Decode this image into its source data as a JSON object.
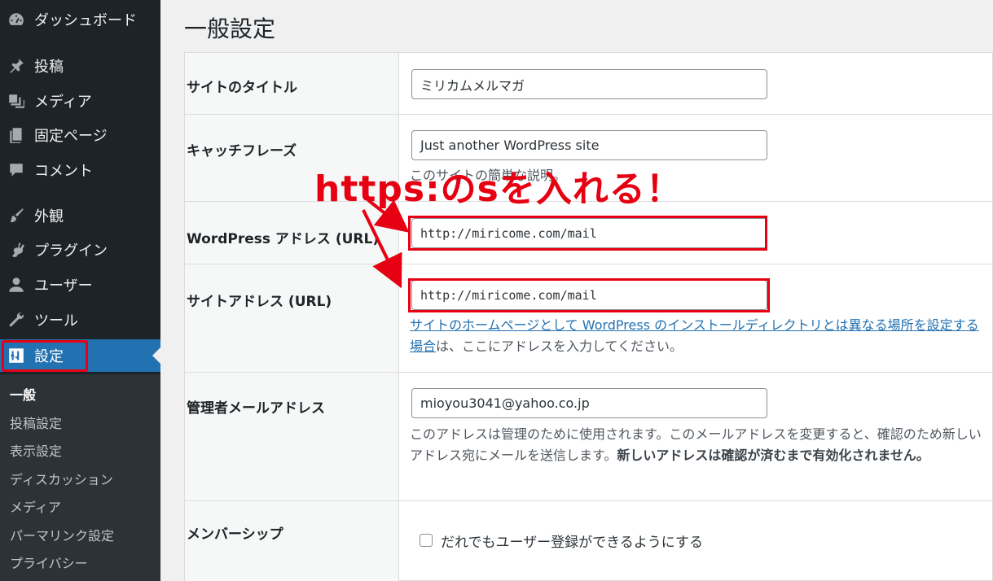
{
  "sidebar": {
    "items": [
      {
        "label": "ダッシュボード",
        "icon": "dashboard-icon"
      },
      {
        "label": "投稿",
        "icon": "pin-icon"
      },
      {
        "label": "メディア",
        "icon": "media-icon"
      },
      {
        "label": "固定ページ",
        "icon": "page-icon"
      },
      {
        "label": "コメント",
        "icon": "comment-icon"
      },
      {
        "label": "外観",
        "icon": "brush-icon"
      },
      {
        "label": "プラグイン",
        "icon": "plugin-icon"
      },
      {
        "label": "ユーザー",
        "icon": "user-icon"
      },
      {
        "label": "ツール",
        "icon": "wrench-icon"
      },
      {
        "label": "設定",
        "icon": "settings-icon"
      }
    ],
    "submenu": [
      "一般",
      "投稿設定",
      "表示設定",
      "ディスカッション",
      "メディア",
      "パーマリンク設定",
      "プライバシー"
    ]
  },
  "page": {
    "title": "一般設定"
  },
  "form": {
    "site_title": {
      "label": "サイトのタイトル",
      "value": "ミリカムメルマガ"
    },
    "tagline": {
      "label": "キャッチフレーズ",
      "value": "Just another WordPress site",
      "desc": "このサイトの簡単な説明。"
    },
    "wp_address": {
      "label": "WordPress アドレス (URL)",
      "value": "http://miricome.com/mail"
    },
    "site_address": {
      "label": "サイトアドレス (URL)",
      "value": "http://miricome.com/mail",
      "desc_link": "サイトのホームページとして WordPress のインストールディレクトリとは異なる場所を設定する場合",
      "desc_tail": "は、ここにアドレスを入力してください。"
    },
    "admin_email": {
      "label": "管理者メールアドレス",
      "value": "mioyou3041@yahoo.co.jp",
      "desc": "このアドレスは管理のために使用されます。このメールアドレスを変更すると、確認のため新しいアドレス宛にメールを送信します。",
      "desc_bold": "新しいアドレスは確認が済むまで有効化されません。"
    },
    "membership": {
      "label": "メンバーシップ",
      "checkbox_label": "だれでもユーザー登録ができるようにする"
    }
  },
  "annotation": {
    "text": "https:のsを入れる！",
    "color": "#e60012"
  },
  "colors": {
    "sidebar_bg": "#1d2327",
    "active_bg": "#2271b1",
    "link": "#2271b1",
    "highlight": "#e60012"
  }
}
